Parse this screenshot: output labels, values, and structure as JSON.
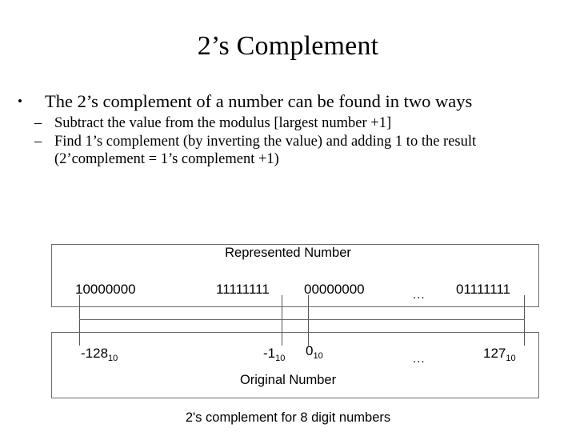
{
  "slide": {
    "title": "2’s Complement",
    "bullets": [
      {
        "marker": "•",
        "text": "The 2’s complement of a number can be found in two ways",
        "sub": [
          {
            "marker": "–",
            "text": "Subtract the value from the modulus [largest number +1]"
          },
          {
            "marker": "–",
            "text": "Find 1’s complement (by inverting the value) and adding 1 to the result (2’complement = 1’s complement +1)"
          }
        ]
      }
    ]
  },
  "diagram": {
    "top_box_label": "Represented Number",
    "bottom_box_label": "Original Number",
    "caption": "2's  complement for 8 digit numbers",
    "ellipsis": "...",
    "binary_values": [
      "10000000",
      "11111111",
      "00000000",
      "01111111"
    ],
    "decimal_values": [
      {
        "value": "-128",
        "subscript": "10"
      },
      {
        "value": "-1",
        "subscript": "10"
      },
      {
        "value": "0",
        "subscript": "10"
      },
      {
        "value": "127",
        "subscript": "10"
      }
    ],
    "colors": {
      "box_border": "#6b6b6b",
      "tick": "#555555",
      "text": "#000000",
      "background": "#ffffff"
    }
  }
}
